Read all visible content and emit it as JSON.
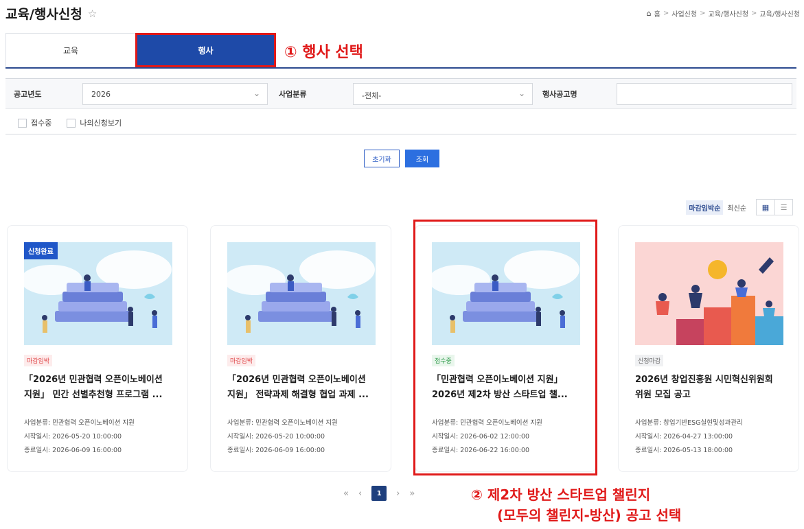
{
  "header": {
    "title": "교육/행사신청",
    "breadcrumb": [
      "홈",
      "사업신청",
      "교육/행사신청",
      "교육/행사신청"
    ]
  },
  "tabs": [
    {
      "label": "교육",
      "active": false
    },
    {
      "label": "행사",
      "active": true
    }
  ],
  "annotations": {
    "step1": "① 행사 선택",
    "step2_line1": "② 제2차 방산 스타트업 챌린지",
    "step2_line2": "(모두의 챌린지-방산) 공고 선택"
  },
  "filters": {
    "year_label": "공고년도",
    "year_value": "2026",
    "category_label": "사업분류",
    "category_value": "-전체-",
    "name_label": "행사공고명",
    "name_value": "",
    "check_receiving": "접수중",
    "check_mine": "나의신청보기"
  },
  "buttons": {
    "reset": "초기화",
    "search": "조회"
  },
  "sort": {
    "deadline": "마감임박순",
    "latest": "최신순"
  },
  "cards": [
    {
      "badge": "신청완료",
      "status": "마감임박",
      "title": "「2026년 민관협력 오픈이노베이션 지원」 민간 선별추천형 프로그램 ...",
      "category": "사업분류:  민관협력 오픈이노베이션 지원",
      "start": "시작일시:  2026-05-20 10:00:00",
      "end": "종료일시:  2026-06-09 16:00:00"
    },
    {
      "badge": "",
      "status": "마감임박",
      "title": "「2026년 민관협력 오픈이노베이션 지원」 전략과제 해결형 협업 과제 ...",
      "category": "사업분류:  민관협력 오픈이노베이션 지원",
      "start": "시작일시:  2026-05-20 10:00:00",
      "end": "종료일시:  2026-06-09 16:00:00"
    },
    {
      "badge": "",
      "status": "접수중",
      "title": "「민관협력 오픈이노베이션 지원」 2026년 제2차 방산 스타트업 챌...",
      "category": "사업분류:  민관협력 오픈이노베이션 지원",
      "start": "시작일시:  2026-06-02 12:00:00",
      "end": "종료일시:  2026-06-22 16:00:00"
    },
    {
      "badge": "",
      "status": "신청마감",
      "title": "2026년 창업진흥원 시민혁신위원회 위원 모집 공고",
      "category": "사업분류:  창업기반ESG실현및성과관리",
      "start": "시작일시:  2026-04-27 13:00:00",
      "end": "종료일시:  2026-05-13 18:00:00"
    }
  ],
  "pagination": {
    "first": "«",
    "prev": "‹",
    "current": "1",
    "next": "›",
    "last": "»"
  },
  "colors": {
    "primary": "#1e4aa8",
    "annotation_red": "#e01919",
    "pager_active": "#1e3f7d"
  }
}
